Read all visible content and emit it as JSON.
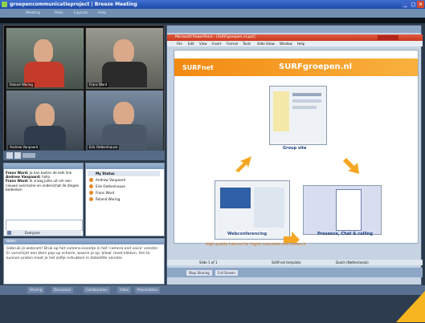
{
  "window": {
    "title": "groepencommunicatieproject | Breeze Meeting",
    "accent": "#1d4aa8"
  },
  "menu": [
    "Meeting",
    "Pods",
    "Layouts",
    "Help"
  ],
  "video": {
    "participants": [
      {
        "name": "Roland Waring"
      },
      {
        "name": "Frans Ward"
      },
      {
        "name": "Andrew Vanpaard"
      },
      {
        "name": "Erik Oetkenhause"
      }
    ]
  },
  "chat": {
    "messages": [
      {
        "who": "Frans Ward:",
        "text": "Ja kan buiten de kelk link"
      },
      {
        "who": "Andrew Vanpaard:",
        "text": "hallo"
      },
      {
        "who": "Frans Ward:",
        "text": "Ik vraag jullie uit om een nieuwe overname en onderschat de dingen bedenken"
      }
    ],
    "to_label": "Everyone"
  },
  "participants_panel": {
    "header": "My Status",
    "items": [
      "Andrew Vanpaard",
      "Erik Oetkenhause",
      "Frans Ward",
      "Roland Waring"
    ]
  },
  "notes": {
    "heading": "Notes",
    "text": "Gebruik je webcam! Druk op het camera-icoontje in het 'camera and voice' venster. Er verschijnt een klein pop-up scherm, waarin je op 'allow' moet klikken. Om te kunnen praten moet je het zelfje indrukken in datzelfde venster."
  },
  "bottom_tabs": [
    "Sharing",
    "Discussion",
    "Collaboration",
    "Video",
    "Presentation"
  ],
  "ppt": {
    "window_title": "Microsoft PowerPoint - [SURFgroepen.nl.ppt]",
    "menu": [
      "File",
      "Edit",
      "View",
      "Insert",
      "Format",
      "Tools",
      "Slide Show",
      "Window",
      "Help"
    ],
    "slide": {
      "logo": "SURFnet",
      "title": "SURFgroepen.nl",
      "label_group_site": "Group site",
      "label_web": "Webconferencing",
      "label_presence": "Presence, Chat & calling",
      "footer": "High quality internet for higher education and research"
    },
    "status": {
      "slide": "Slide 1 of 1",
      "template": "SURFnet template",
      "language": "Dutch (Netherlands)"
    },
    "buttons": [
      "Stop Sharing",
      "Full Screen"
    ]
  }
}
